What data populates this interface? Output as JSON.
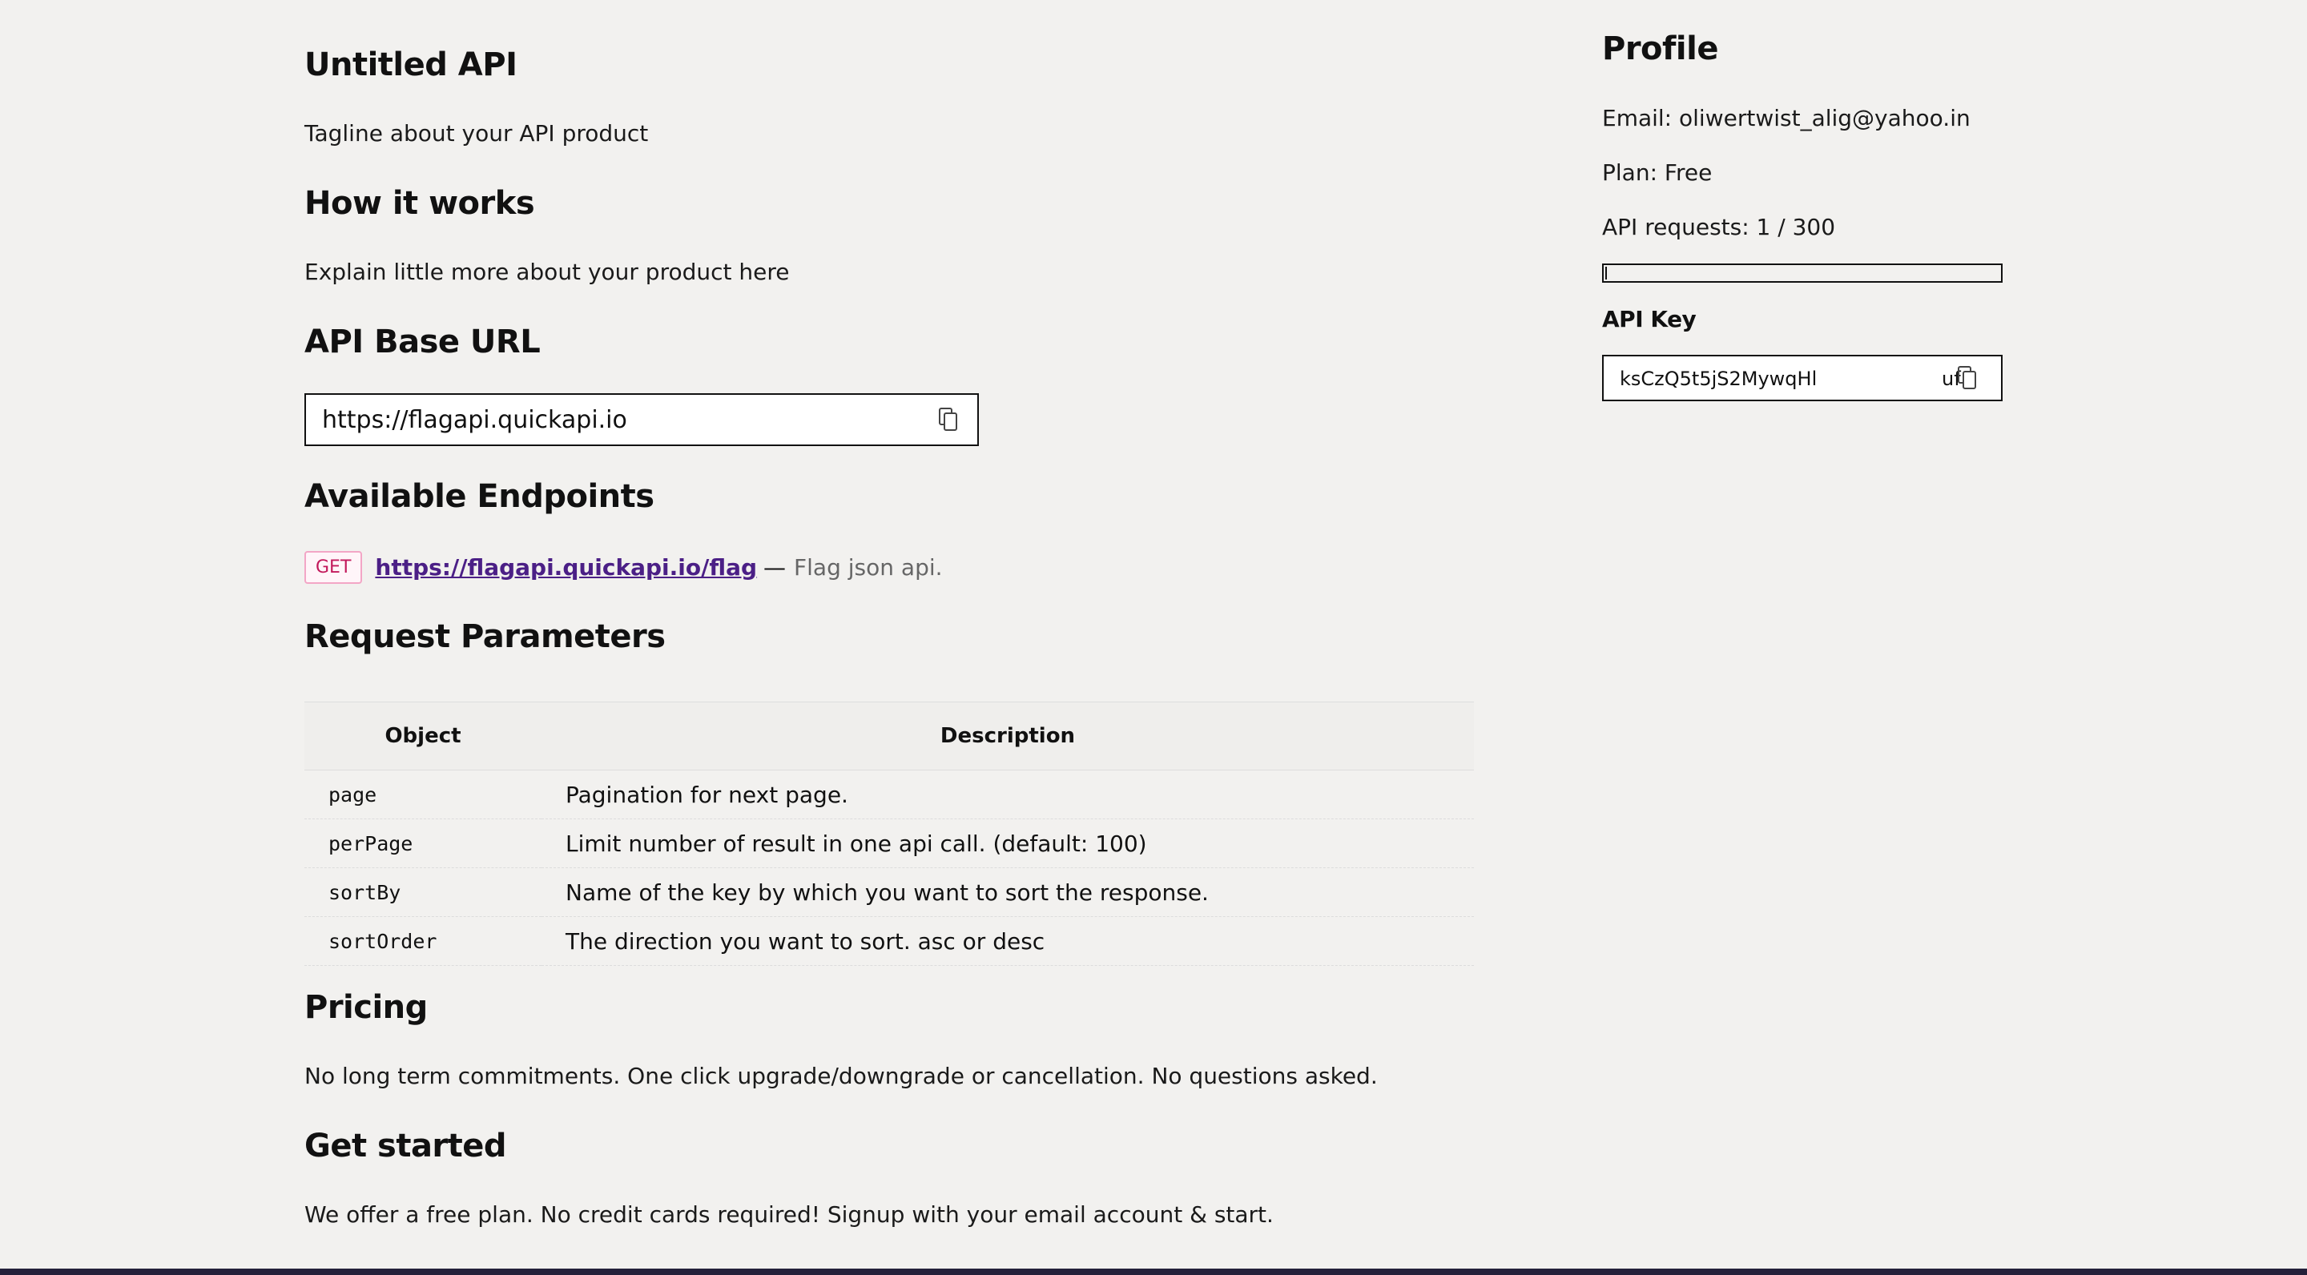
{
  "main": {
    "title": "Untitled API",
    "tagline": "Tagline about your API product",
    "how_it_works": {
      "heading": "How it works",
      "text": "Explain little more about your product here"
    },
    "base_url": {
      "heading": "API Base URL",
      "value": "https://flagapi.quickapi.io",
      "copy_icon": "copy-icon"
    },
    "endpoints": {
      "heading": "Available Endpoints",
      "items": [
        {
          "method": "GET",
          "url": "https://flagapi.quickapi.io/flag",
          "separator": "—",
          "description": "Flag json api."
        }
      ]
    },
    "params": {
      "heading": "Request Parameters",
      "columns": [
        "Object",
        "Description"
      ],
      "rows": [
        {
          "object": "page",
          "description": "Pagination for next page."
        },
        {
          "object": "perPage",
          "description": "Limit number of result in one api call. (default: 100)"
        },
        {
          "object": "sortBy",
          "description": "Name of the key by which you want to sort the response."
        },
        {
          "object": "sortOrder",
          "description": "The direction you want to sort. asc or desc"
        }
      ]
    },
    "pricing": {
      "heading": "Pricing",
      "text": "No long term commitments. One click upgrade/downgrade or cancellation. No questions asked."
    },
    "get_started": {
      "heading": "Get started",
      "text": "We offer a free plan. No credit cards required! Signup with your email account & start."
    }
  },
  "profile": {
    "heading": "Profile",
    "email": "Email: oliwertwist_alig@yahoo.in",
    "plan": "Plan: Free",
    "requests": "API requests: 1 / 300",
    "requests_used_fraction": 0.0033,
    "api_key_heading": "API Key",
    "api_key": "ksCzQ5t5jS2MywqHl",
    "api_key_tail": "uf",
    "copy_icon": "copy-icon"
  },
  "colors": {
    "background": "#f2f1ef",
    "link": "#4b1f86",
    "badge_text": "#c2185b",
    "badge_border": "#f3a6c6"
  }
}
